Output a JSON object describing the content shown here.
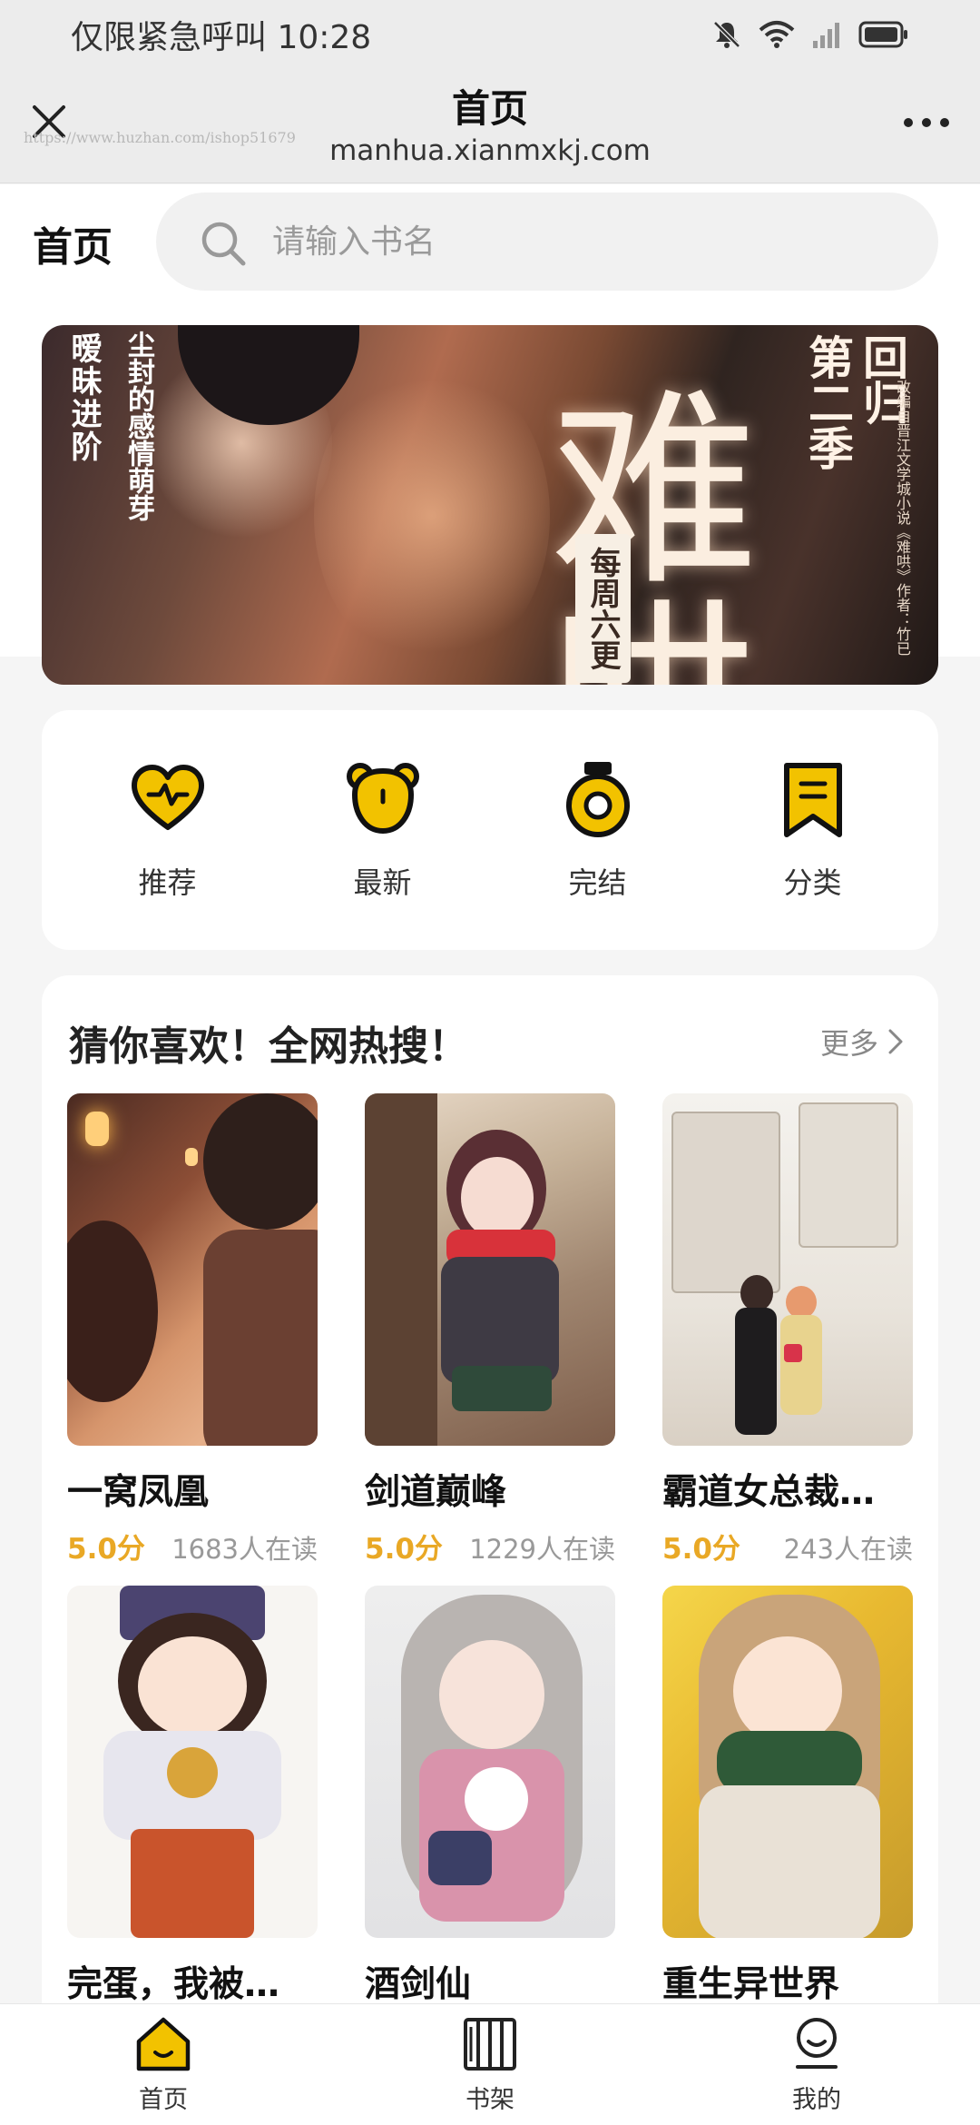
{
  "status_bar": {
    "carrier_time": "仅限紧急呼叫 10:28",
    "icons": [
      "mute-bell-icon",
      "wifi-icon",
      "signal-icon",
      "battery-icon"
    ]
  },
  "browser": {
    "title": "首页",
    "domain": "manhua.xianmxkj.com",
    "watermark": "https://www.huzhan.com/ishop51679",
    "close_icon": "close-icon",
    "more_icon": "more-dots-icon"
  },
  "header": {
    "label": "首页",
    "search_placeholder": "请输入书名"
  },
  "banner": {
    "big_char": "难哄",
    "line1": "暧昧进阶",
    "line2": "尘封的感情萌芽",
    "season1": "第二季",
    "season2": "回归",
    "side_note": "改编自晋江文学城小说《难哄》作者：竹已",
    "tag": "每周六更"
  },
  "categories": [
    {
      "label": "推荐",
      "icon": "heart-pulse-icon"
    },
    {
      "label": "最新",
      "icon": "bear-icon"
    },
    {
      "label": "完结",
      "icon": "medal-icon"
    },
    {
      "label": "分类",
      "icon": "bookmark-icon"
    }
  ],
  "recommend": {
    "title": "猜你喜欢！全网热搜！",
    "more_label": "更多",
    "books": [
      {
        "name": "一窝凤凰",
        "score": "5.0分",
        "readers": "1683人在读"
      },
      {
        "name": "剑道巅峰",
        "score": "5.0分",
        "readers": "1229人在读"
      },
      {
        "name": "霸道女总裁…",
        "score": "5.0分",
        "readers": "243人在读"
      },
      {
        "name": "完蛋，我被…",
        "score": "",
        "readers": ""
      },
      {
        "name": "酒剑仙",
        "score": "",
        "readers": ""
      },
      {
        "name": "重生异世界",
        "score": "",
        "readers": ""
      }
    ]
  },
  "bottom_nav": [
    {
      "label": "首页",
      "icon": "home-icon"
    },
    {
      "label": "书架",
      "icon": "bookshelf-icon"
    },
    {
      "label": "我的",
      "icon": "profile-icon"
    }
  ],
  "colors": {
    "accent": "#f2c200",
    "score": "#e9a825",
    "background": "#f5f5f5"
  }
}
